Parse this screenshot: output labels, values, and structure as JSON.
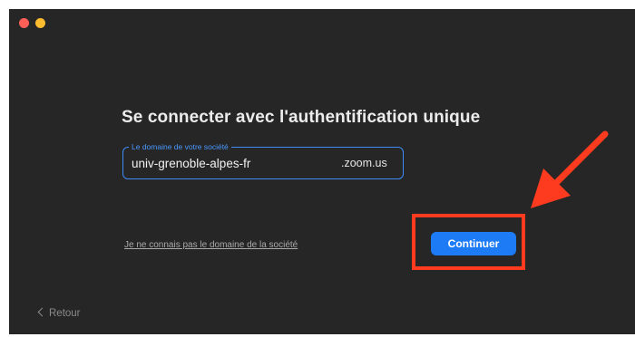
{
  "window": {
    "controls": [
      "close",
      "minimize"
    ]
  },
  "sso": {
    "title": "Se connecter avec l'authentification unique",
    "domain_field": {
      "label": "Le domaine de votre société",
      "value": "univ-grenoble-alpes-fr",
      "suffix": ".zoom.us"
    },
    "unknown_domain_link": "Je ne connais pas le domaine de la société",
    "continue_label": "Continuer",
    "back_label": "Retour"
  },
  "annotation": {
    "color": "#ff3b1f",
    "arrow_icon": "red-arrow-icon"
  },
  "colors": {
    "window_bg": "#262626",
    "accent": "#1e7bf6",
    "field_border": "#3d8cf5"
  }
}
